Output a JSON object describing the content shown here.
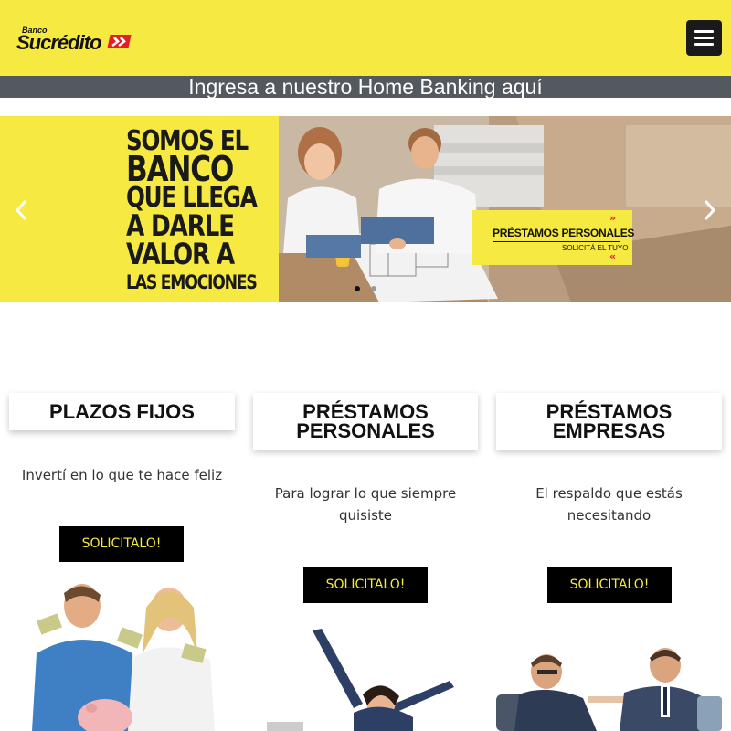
{
  "header": {
    "logo_small": "Banco",
    "logo_main": "Sucrédito",
    "menu_icon": "hamburger-menu-icon",
    "background_color": "#f6e942"
  },
  "home_banking": {
    "link_text": "Ingresa a nuestro Home Banking aquí",
    "bar_color": "#54595f"
  },
  "slider": {
    "slogan": [
      "SOMOS EL",
      "BANCO",
      "QUE LLEGA",
      "A DARLE",
      "VALOR A",
      "LAS EMOCIONES"
    ],
    "promo_title": "PRÉSTAMOS PERSONALES",
    "promo_subtitle": "SOLICITÁ EL TUYO",
    "prev_icon": "chevron-left-icon",
    "next_icon": "chevron-right-icon",
    "slide_count": 2,
    "active_slide": 1
  },
  "cards": [
    {
      "title": "PLAZOS FIJOS",
      "description": "Invertí en lo que te hace feliz",
      "button": "SOLICITALO!"
    },
    {
      "title": "PRÉSTAMOS PERSONALES",
      "title_line1": "PRÉSTAMOS",
      "title_line2": "PERSONALES",
      "description": "Para lograr lo que siempre quisiste",
      "desc_line1": "Para lograr lo que siempre",
      "desc_line2": "quisiste",
      "button": "SOLICITALO!"
    },
    {
      "title": "PRÉSTAMOS EMPRESAS",
      "title_line1": "PRÉSTAMOS",
      "title_line2": "EMPRESAS",
      "description": "El respaldo que estás necesitando",
      "desc_line1": "El respaldo que estás",
      "desc_line2": "necesitando",
      "button": "SOLICITALO!"
    }
  ],
  "colors": {
    "brand_yellow": "#f6e942",
    "brand_red": "#e31e24",
    "button_bg": "#000000"
  }
}
